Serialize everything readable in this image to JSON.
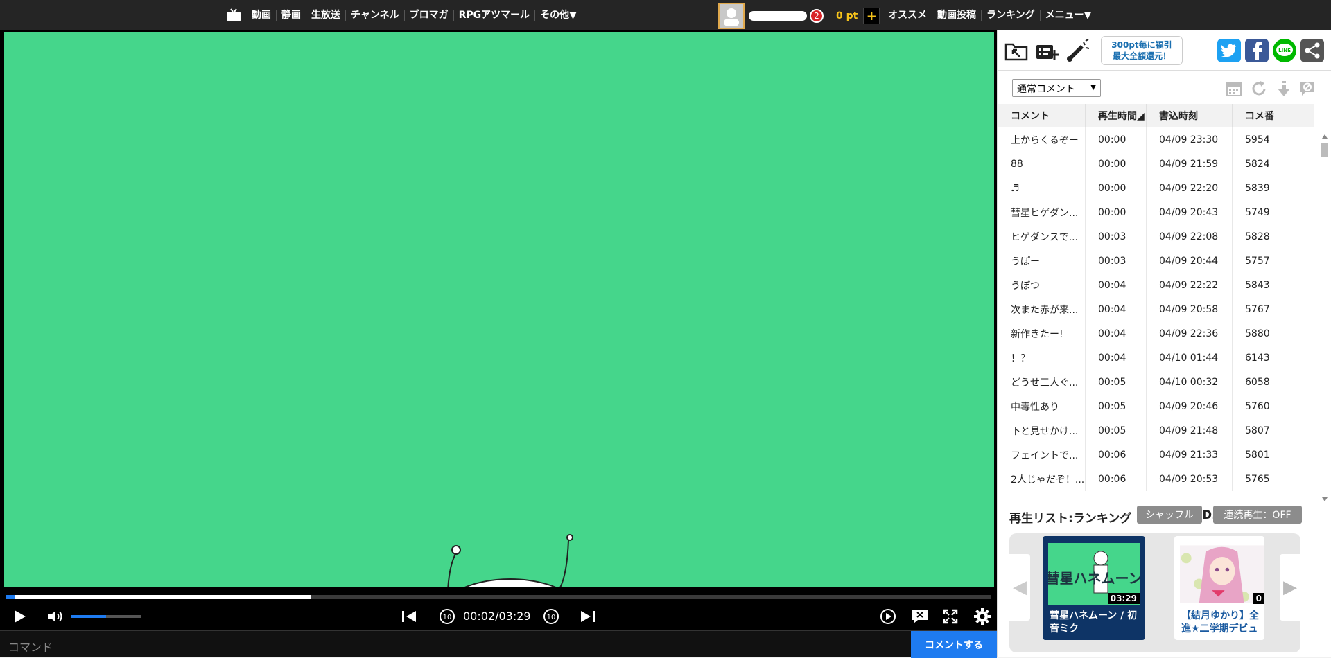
{
  "topbar": {
    "nav": [
      "動画",
      "静画",
      "生放送",
      "チャンネル",
      "ブロマガ",
      "RPGアツマール",
      "その他▼"
    ],
    "notifications": "2",
    "points": "0 pt",
    "plus": "+",
    "right_nav": [
      "オススメ",
      "動画投稿",
      "ランキング",
      "メニュー▼"
    ]
  },
  "player": {
    "time": "00:02/03:29",
    "progress_fraction": 0.0096,
    "buffered_fraction": 0.31,
    "volume_fraction": 0.5,
    "command_placeholder": "コマンド",
    "comment_button": "コメントする"
  },
  "side": {
    "promo_line1": "300pt毎に福引",
    "promo_line2": "最大全額還元！",
    "comment_type": "通常コメント",
    "columns": [
      "コメント",
      "再生時間◢",
      "書込時刻",
      "コメ番"
    ],
    "comments": [
      {
        "text": "上からくるぞー",
        "time": "00:00",
        "posted": "04/09 23:30",
        "no": "5954"
      },
      {
        "text": "88",
        "time": "00:00",
        "posted": "04/09 21:59",
        "no": "5824"
      },
      {
        "text": "♬",
        "time": "00:00",
        "posted": "04/09 22:20",
        "no": "5839"
      },
      {
        "text": "彗星ヒゲダン...",
        "time": "00:00",
        "posted": "04/09 20:43",
        "no": "5749"
      },
      {
        "text": "ヒゲダンスで...",
        "time": "00:03",
        "posted": "04/09 22:08",
        "no": "5828"
      },
      {
        "text": "うぽー",
        "time": "00:03",
        "posted": "04/09 20:44",
        "no": "5757"
      },
      {
        "text": "うぽつ",
        "time": "00:04",
        "posted": "04/09 22:22",
        "no": "5843"
      },
      {
        "text": "次また赤が来...",
        "time": "00:04",
        "posted": "04/09 20:58",
        "no": "5767"
      },
      {
        "text": "新作きたー!",
        "time": "00:04",
        "posted": "04/09 22:36",
        "no": "5880"
      },
      {
        "text": "！？",
        "time": "00:04",
        "posted": "04/10 01:44",
        "no": "6143"
      },
      {
        "text": "どうせ三人ぐ...",
        "time": "00:05",
        "posted": "04/10 00:32",
        "no": "6058"
      },
      {
        "text": "中毒性あり",
        "time": "00:05",
        "posted": "04/09 20:46",
        "no": "5760"
      },
      {
        "text": "下と見せかけ...",
        "time": "00:05",
        "posted": "04/09 21:48",
        "no": "5807"
      },
      {
        "text": "フェイントで...",
        "time": "00:06",
        "posted": "04/09 21:33",
        "no": "5801"
      },
      {
        "text": "2人じゃだぞ！...",
        "time": "00:06",
        "posted": "04/09 20:53",
        "no": "5765"
      }
    ],
    "playlist_title": "再生リスト:ランキング",
    "shuffle": "シャッフル",
    "letter_d": "D.",
    "autoplay": "連続再生：OFF",
    "cards": [
      {
        "title": "彗星ハネムーン / 初音ミク",
        "duration": "03:29",
        "thumb_text": "彗星ハネムーン",
        "active": true
      },
      {
        "title": "【結月ゆかり】全力前進★二学期デビュ",
        "duration": "0",
        "thumb_text": "",
        "active": false
      }
    ]
  }
}
